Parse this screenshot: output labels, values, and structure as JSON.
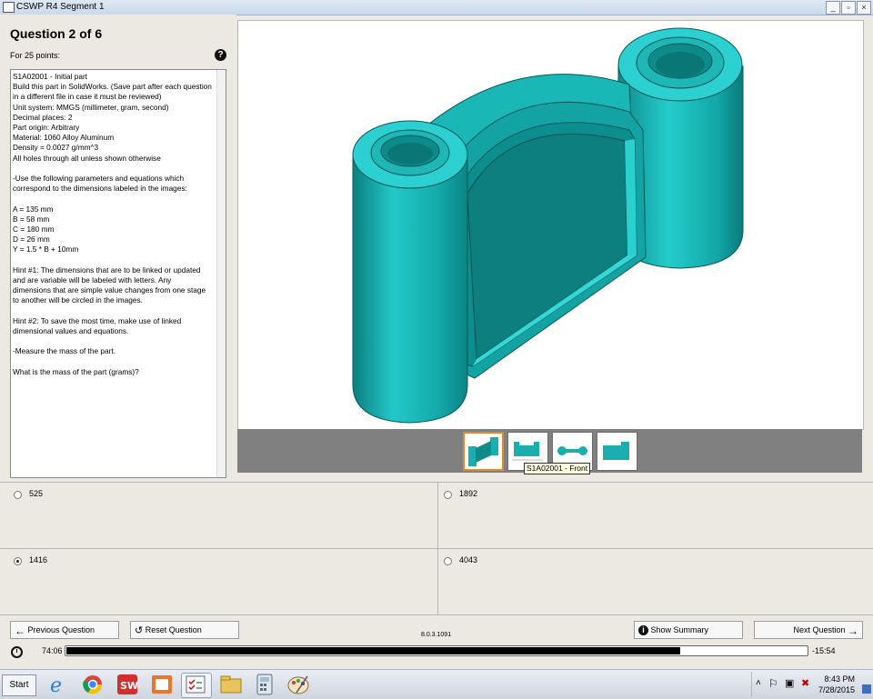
{
  "window": {
    "title": "CSWP R4 Segment 1",
    "controls": [
      "_",
      "▫",
      "×"
    ]
  },
  "question": {
    "heading": "Question 2 of 6",
    "points": "For 25 points:",
    "help_icon": "question-circle-icon",
    "text_lines": [
      "S1A02001 - Initial part",
      "Build this part in SolidWorks. (Save part after each question",
      "in a different file in case it must be reviewed)",
      "Unit system: MMGS (millimeter, gram, second)",
      "Decimal places: 2",
      "Part origin: Arbitrary",
      "Material: 1060 Alloy Aluminum",
      "Density = 0.0027 g/mm^3",
      "All holes through all unless shown otherwise",
      "",
      "-Use the following parameters and equations which",
      "correspond to the dimensions labeled in the images:",
      "",
      "A = 135 mm",
      "B = 58 mm",
      "C = 180 mm",
      "D = 26 mm",
      "Y = 1.5 * B + 10mm",
      "",
      "Hint #1: The dimensions that are to be linked or updated",
      "and are variable will be labeled with letters. Any",
      "dimensions that are simple value changes from one stage",
      "to another will be circled in the images.",
      "",
      "Hint #2: To save the most time, make use of linked",
      "dimensional values and equations.",
      "",
      "-Measure the mass of the part.",
      "",
      "What is the mass of the part (grams)?"
    ]
  },
  "viewer": {
    "model_color": "#1fbdbd",
    "thumbnails": [
      {
        "name": "thumbnail-iso",
        "selected": true
      },
      {
        "name": "thumbnail-front",
        "selected": false
      },
      {
        "name": "thumbnail-top",
        "selected": false
      },
      {
        "name": "thumbnail-side",
        "selected": false
      }
    ],
    "tooltip": "S1A02001 - Front"
  },
  "answers": [
    {
      "label": "525",
      "selected": false
    },
    {
      "label": "1892",
      "selected": false
    },
    {
      "label": "1416",
      "selected": true
    },
    {
      "label": "4043",
      "selected": false
    }
  ],
  "nav": {
    "previous": "Previous Question",
    "reset": "Reset Question",
    "version": "8.0.3.1091",
    "summary": "Show Summary",
    "next": "Next Question"
  },
  "timer": {
    "elapsed": "74:06",
    "remaining": "-15:54",
    "progress": 0.831
  },
  "taskbar": {
    "start": "Start",
    "apps": [
      "ie-icon",
      "chrome-icon",
      "solidworks-icon",
      "edrawings-icon",
      "tester-icon",
      "explorer-icon",
      "calculator-icon",
      "paint-icon"
    ],
    "time": "8:43 PM",
    "date": "7/28/2015"
  }
}
